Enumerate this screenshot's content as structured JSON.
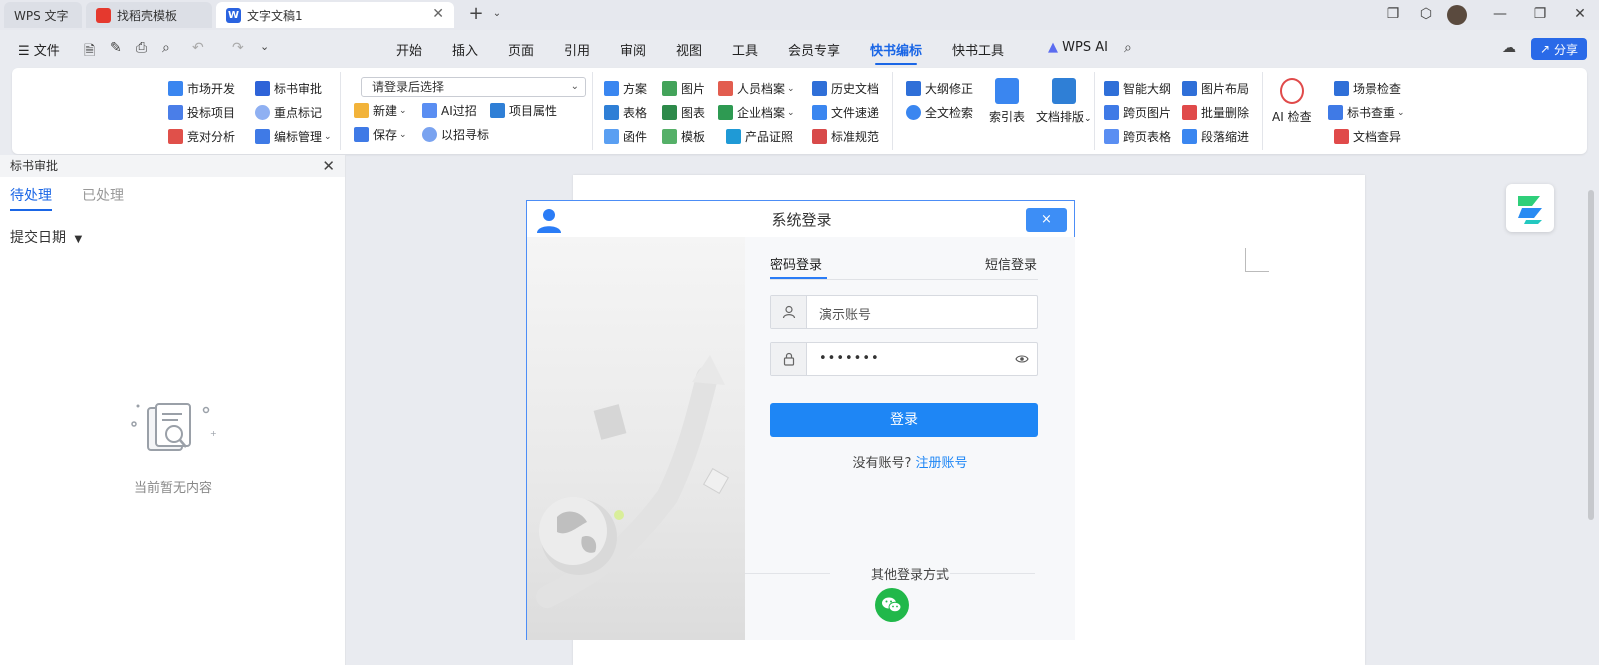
{
  "tabs": [
    {
      "label": "WPS 文字"
    },
    {
      "label": "找稻壳模板"
    },
    {
      "label": "文字文稿1"
    }
  ],
  "menu": {
    "file": "文件",
    "items": [
      "开始",
      "插入",
      "页面",
      "引用",
      "审阅",
      "视图",
      "工具",
      "会员专享",
      "快书编标",
      "快书工具"
    ],
    "wps_ai": "WPS AI",
    "share": "分享"
  },
  "ribbon": {
    "g1": [
      "市场开发",
      "投标项目",
      "竞对分析",
      "标书审批",
      "重点标记",
      "编标管理"
    ],
    "select_placeholder": "请登录后选择",
    "g2": [
      "新建",
      "保存",
      "AI过招",
      "以招寻标",
      "项目属性"
    ],
    "g3": [
      "方案",
      "表格",
      "函件",
      "图片",
      "图表",
      "模板",
      "人员档案",
      "企业档案",
      "产品证照",
      "历史文档",
      "文件速递",
      "标准规范"
    ],
    "g4": [
      "大纲修正",
      "全文检索",
      "索引表",
      "文档排版"
    ],
    "g5": [
      "智能大纲",
      "跨页图片",
      "跨页表格",
      "图片布局",
      "批量删除",
      "段落缩进"
    ],
    "g6": [
      "AI 检查",
      "场景检查",
      "标书查重",
      "文档查异"
    ]
  },
  "left_panel": {
    "title": "标书审批",
    "tab_pending": "待处理",
    "tab_done": "已处理",
    "submit_date": "提交日期",
    "empty_text": "当前暂无内容"
  },
  "login": {
    "title": "系统登录",
    "close": "×",
    "tab_password": "密码登录",
    "tab_sms": "短信登录",
    "account_placeholder": "演示账号",
    "password_value": "•••••••",
    "login_button": "登录",
    "no_account": "没有账号?",
    "register": "注册账号",
    "other_methods": "其他登录方式"
  },
  "colors": {
    "accent": "#1a66e6",
    "login_button": "#1e86f5",
    "dialog_border": "#4c8df6",
    "wechat": "#21b84a"
  }
}
